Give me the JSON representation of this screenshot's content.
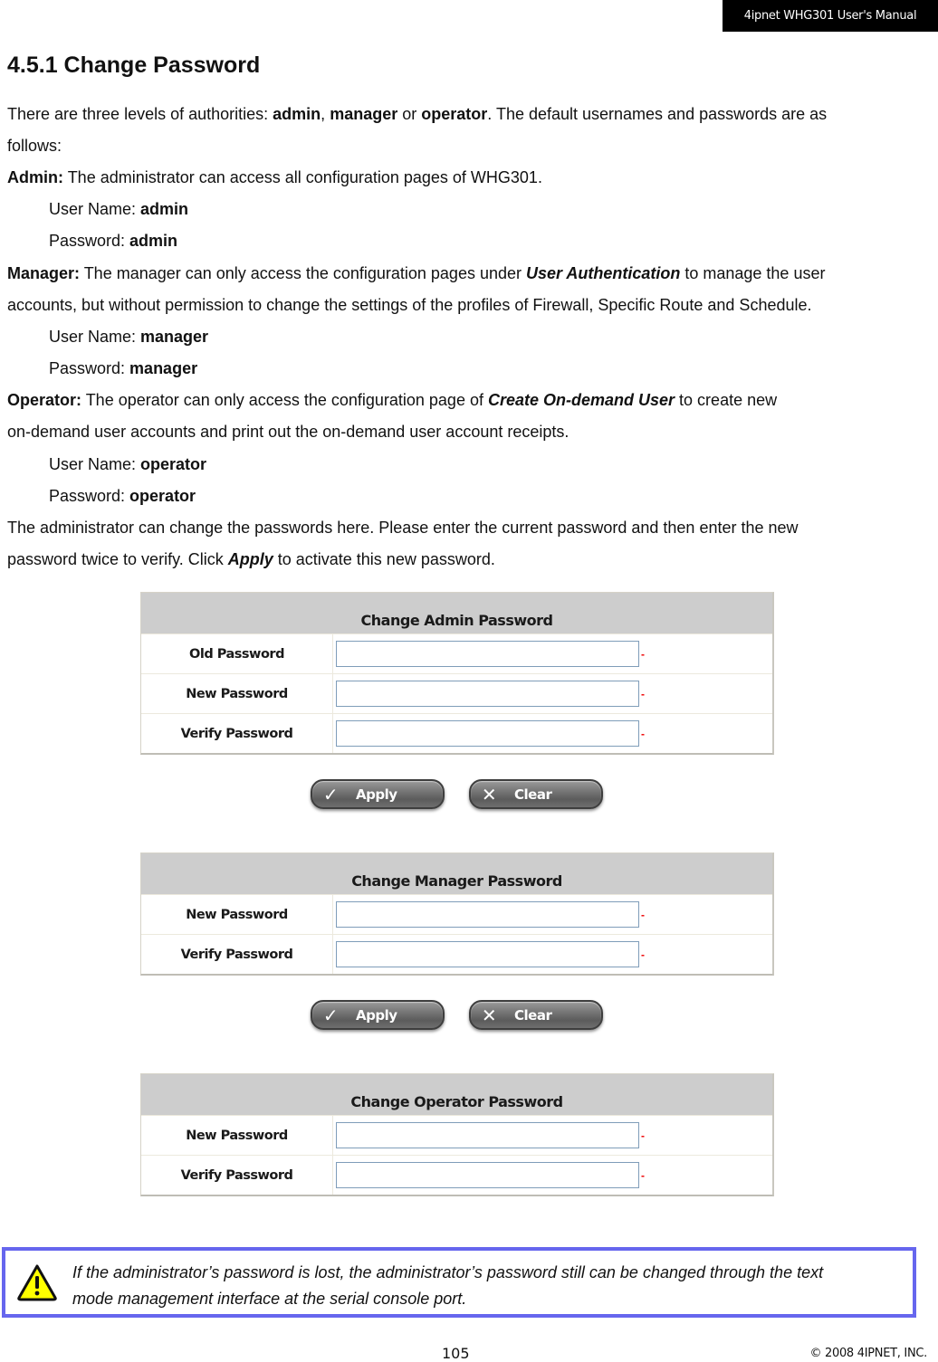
{
  "header": {
    "manual_title": "4ipnet WHG301 User's Manual"
  },
  "section": {
    "title": "4.5.1 Change Password"
  },
  "intro": {
    "line1_pre": "There are three levels of authorities: ",
    "admin": "admin",
    "comma": ", ",
    "manager": "manager",
    "or": " or ",
    "operator": "operator",
    "line1_post": ". The default usernames and passwords are as",
    "line2": "follows:"
  },
  "roles": [
    {
      "label": "Admin:",
      "desc_lines": [
        "The administrator can access all configuration pages of WHG301."
      ],
      "username_label": "User Name: ",
      "username": "admin",
      "password_label": "Password: ",
      "password": "admin"
    },
    {
      "label": "Manager:",
      "desc_pre": " The manager can only access the configuration pages under ",
      "desc_emph": "User Authentication",
      "desc_post": " to manage the user",
      "desc_line2": "accounts, but without permission to change the settings of the profiles of Firewall, Specific Route and Schedule.",
      "username_label": "User Name: ",
      "username": "manager",
      "password_label": "Password: ",
      "password": "manager"
    },
    {
      "label": "Operator:",
      "desc_pre": " The operator can only access the configuration page of ",
      "desc_emph": "Create On-demand User",
      "desc_post": " to create new",
      "desc_line2": "on-demand user accounts and print out the on-demand user account receipts.",
      "username_label": "User Name: ",
      "username": "operator",
      "password_label": "Password: ",
      "password": "operator"
    }
  ],
  "instructions": {
    "line1": "The administrator can change the passwords here. Please enter the current password and then enter the new",
    "line2_pre": "password twice to verify. Click ",
    "line2_emph": "Apply",
    "line2_post": " to activate this new password."
  },
  "forms": {
    "admin": {
      "title": "Change Admin Password",
      "fields": [
        {
          "label": "Old Password",
          "value": "",
          "required_mark": "-"
        },
        {
          "label": "New Password",
          "value": "",
          "required_mark": "-"
        },
        {
          "label": "Verify Password",
          "value": "",
          "required_mark": "-"
        }
      ],
      "apply_label": "Apply",
      "clear_label": "Clear"
    },
    "manager": {
      "title": "Change Manager Password",
      "fields": [
        {
          "label": "New Password",
          "value": "",
          "required_mark": "-"
        },
        {
          "label": "Verify Password",
          "value": "",
          "required_mark": "-"
        }
      ],
      "apply_label": "Apply",
      "clear_label": "Clear"
    },
    "operator": {
      "title": "Change Operator Password",
      "fields": [
        {
          "label": "New Password",
          "value": "",
          "required_mark": "-"
        },
        {
          "label": "Verify Password",
          "value": "",
          "required_mark": "-"
        }
      ]
    }
  },
  "note": {
    "icon": "warning-icon",
    "line1": "If the administrator’s password is lost, the administrator’s password still can be changed through the text",
    "line2": "mode management interface at the serial console port."
  },
  "footer": {
    "page_number": "105",
    "copyright": "© 2008 4IPNET, INC."
  },
  "colors": {
    "note_border": "#6666ee",
    "required_mark": "#ee0000",
    "form_header_bg": "#cdcdcd"
  }
}
